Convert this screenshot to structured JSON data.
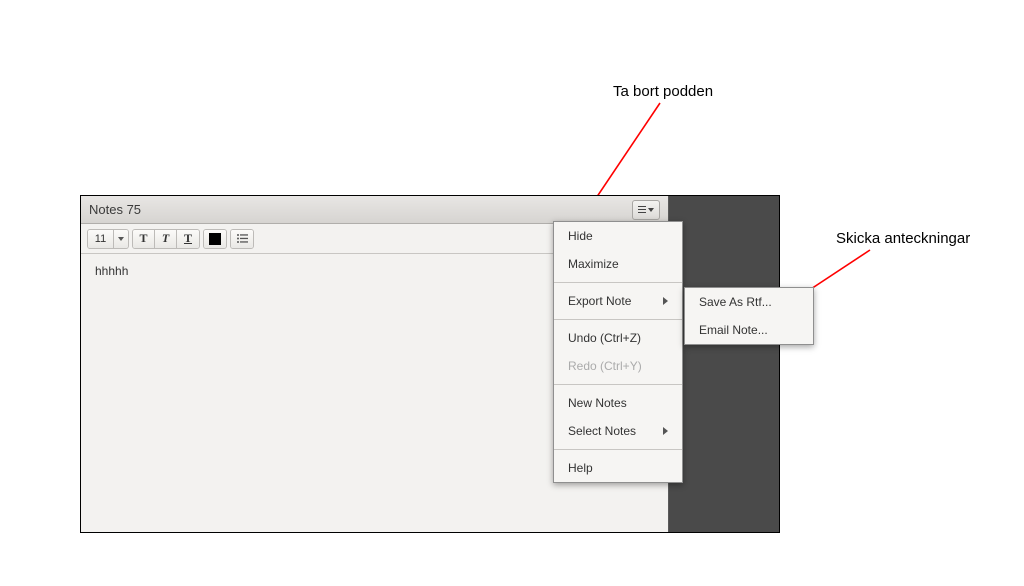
{
  "annotations": {
    "top": "Ta bort podden",
    "right": "Skicka anteckningar"
  },
  "panel": {
    "title": "Notes 75"
  },
  "toolbar": {
    "font_size": "11",
    "bold": "T",
    "italic": "T",
    "underline": "T"
  },
  "content": {
    "text": "hhhhh"
  },
  "menu": {
    "hide": "Hide",
    "maximize": "Maximize",
    "export_note": "Export Note",
    "undo": "Undo (Ctrl+Z)",
    "redo": "Redo (Ctrl+Y)",
    "new_notes": "New Notes",
    "select_notes": "Select Notes",
    "help": "Help"
  },
  "submenu": {
    "save_as_rtf": "Save As Rtf...",
    "email_note": "Email Note..."
  }
}
